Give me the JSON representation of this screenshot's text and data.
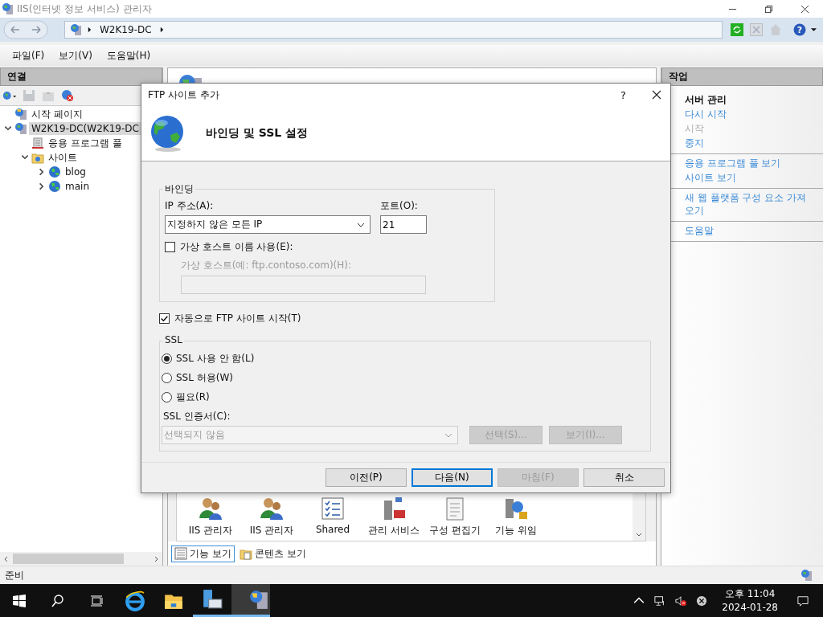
{
  "window": {
    "title": "IIS(인터넷 정보 서비스) 관리자"
  },
  "address_bar": {
    "crumbs": [
      "W2K19-DC"
    ],
    "help": "?"
  },
  "menu": [
    "파일(F)",
    "보기(V)",
    "도움말(H)"
  ],
  "connections": {
    "title": "연결",
    "tree": [
      {
        "label": "시작 페이지",
        "kind": "start"
      },
      {
        "label": "W2K19-DC(W2K19-DC",
        "kind": "server",
        "expanded": true,
        "selected": true,
        "children": [
          {
            "label": "응용 프로그램 풀",
            "kind": "pool"
          },
          {
            "label": "사이트",
            "kind": "folder",
            "expanded": true,
            "children": [
              {
                "label": "blog",
                "kind": "site",
                "expanded": false
              },
              {
                "label": "main",
                "kind": "site",
                "expanded": false
              }
            ]
          }
        ]
      }
    ]
  },
  "home": {
    "features": [
      {
        "label": "IIS 관리자",
        "kind": "users"
      },
      {
        "label": "IIS 관리자",
        "kind": "users"
      },
      {
        "label": "Shared",
        "kind": "checklist"
      },
      {
        "label": "관리 서비스",
        "kind": "server"
      },
      {
        "label": "구성 편집기",
        "kind": "document"
      },
      {
        "label": "기능 위임",
        "kind": "delegate"
      }
    ],
    "view_tabs": [
      {
        "label": "기능 보기",
        "selected": true
      },
      {
        "label": "콘텐츠 보기",
        "selected": false
      }
    ]
  },
  "actions": {
    "title": "작업",
    "groups": [
      [
        {
          "label": "서버 관리",
          "kind": "header"
        },
        {
          "label": "다시 시작",
          "kind": "link"
        },
        {
          "label": "시작",
          "kind": "disabled"
        },
        {
          "label": "중지",
          "kind": "link"
        }
      ],
      [
        {
          "label": "응용 프로그램 풀 보기",
          "kind": "link"
        },
        {
          "label": "사이트 보기",
          "kind": "link"
        }
      ],
      [
        {
          "label": "새 웹 플랫폼 구성 요소 가져오기",
          "kind": "link"
        }
      ],
      [
        {
          "label": "도움말",
          "kind": "link"
        }
      ]
    ]
  },
  "status_bar": {
    "text": "준비"
  },
  "dialog": {
    "title": "FTP 사이트 추가",
    "help": "?",
    "heading": "바인딩 및 SSL 설정",
    "binding": {
      "legend": "바인딩",
      "ip_label": "IP 주소(A):",
      "ip_value": "지정하지 않은 모든 IP",
      "port_label": "포트(O):",
      "port_value": "21",
      "virtual_host": {
        "label": "가상 호스트 이름 사용(E):",
        "checked": false
      },
      "host_label": "가상 호스트(예: ftp.contoso.com)(H):",
      "host_disabled": true
    },
    "auto_start": {
      "label": "자동으로 FTP 사이트 시작(T)",
      "checked": true
    },
    "ssl": {
      "legend": "SSL",
      "options": [
        {
          "label": "SSL 사용 안 함(L)",
          "selected": true
        },
        {
          "label": "SSL 허용(W)",
          "selected": false
        },
        {
          "label": "필요(R)",
          "selected": false
        }
      ],
      "cert_label": "SSL 인증서(C):",
      "cert_value": "선택되지 않음",
      "cert_buttons": [
        {
          "label": "선택(S)...",
          "disabled": true
        },
        {
          "label": "보기(I)...",
          "disabled": true
        }
      ]
    },
    "buttons": [
      {
        "label": "이전(P)",
        "disabled": false,
        "default": false
      },
      {
        "label": "다음(N)",
        "disabled": false,
        "default": true
      },
      {
        "label": "마침(F)",
        "disabled": true,
        "default": false
      },
      {
        "label": "취소",
        "disabled": false,
        "default": false
      }
    ]
  },
  "taskbar": {
    "apps": [
      {
        "kind": "ie",
        "running": false,
        "selected": false
      },
      {
        "kind": "explorer",
        "running": false,
        "selected": false
      },
      {
        "kind": "server_manager",
        "running": true,
        "selected": false
      },
      {
        "kind": "iis",
        "running": true,
        "selected": true
      }
    ],
    "time": "오후 11:04",
    "date": "2024-01-28"
  }
}
